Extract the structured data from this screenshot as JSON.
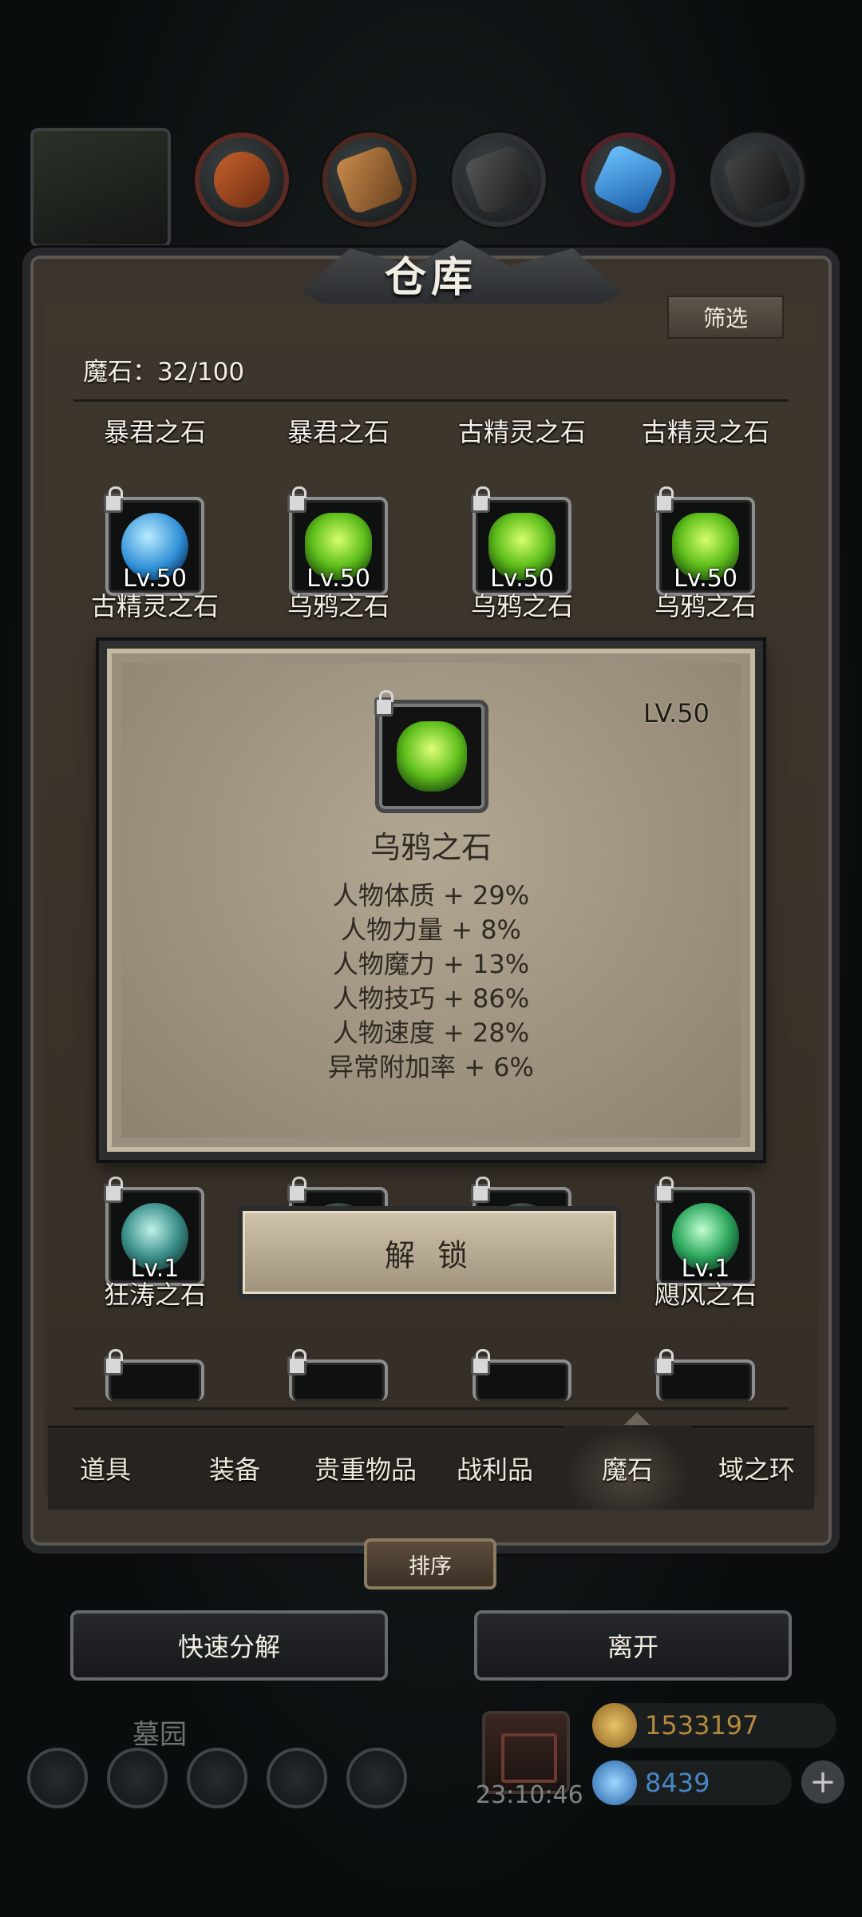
{
  "resources": {
    "portrait_icon": "character-portrait",
    "items": [
      "meat-icon",
      "wood-icon",
      "iron-icon",
      "crystal-icon",
      "ore-icon"
    ]
  },
  "panel": {
    "title": "仓库",
    "filter_label": "筛选",
    "capacity": "魔石：32/100"
  },
  "grid": {
    "row0_names": [
      "暴君之石",
      "暴君之石",
      "古精灵之石",
      "古精灵之石"
    ],
    "row1": [
      {
        "name": "古精灵之石",
        "level": "Lv.50",
        "gem": "blue"
      },
      {
        "name": "乌鸦之石",
        "level": "Lv.50",
        "gem": "green"
      },
      {
        "name": "乌鸦之石",
        "level": "Lv.50",
        "gem": "green"
      },
      {
        "name": "乌鸦之石",
        "level": "Lv.50",
        "gem": "green"
      }
    ],
    "row_lower": [
      {
        "name": "狂涛之石",
        "level": "Lv.1",
        "gem": "teal"
      },
      {
        "name": "",
        "level": "",
        "gem": "dark"
      },
      {
        "name": "",
        "level": "",
        "gem": "dark"
      },
      {
        "name": "飓风之石",
        "level": "Lv.1",
        "gem": "jade"
      }
    ]
  },
  "tooltip": {
    "level": "LV.50",
    "name": "乌鸦之石",
    "stats": [
      "人物体质 + 29%",
      "人物力量 + 8%",
      "人物魔力 + 13%",
      "人物技巧 + 86%",
      "人物速度 + 28%",
      "异常附加率 + 6%"
    ],
    "unlock_label": "解 锁"
  },
  "tabs": [
    {
      "label": "道具",
      "active": false
    },
    {
      "label": "装备",
      "active": false
    },
    {
      "label": "贵重物品",
      "active": false
    },
    {
      "label": "战利品",
      "active": false
    },
    {
      "label": "魔石",
      "active": true
    },
    {
      "label": "域之环",
      "active": false
    }
  ],
  "sort_label": "排序",
  "actions": {
    "decompose_label": "快速分解",
    "leave_label": "离开"
  },
  "hud": {
    "location": "墓园",
    "clock": "23:10:46",
    "gold": "1533197",
    "gems": "8439",
    "colors": {
      "gold": "#b48a3c",
      "gems": "#4a86c6"
    }
  }
}
